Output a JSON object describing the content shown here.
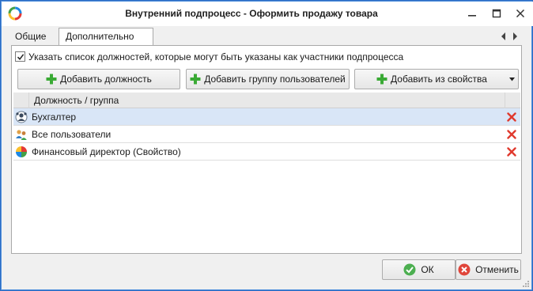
{
  "window": {
    "title": "Внутренний подпроцесс - Оформить продажу товара",
    "icons": {
      "logo": "app-logo-icon",
      "minimize": "minimize-icon",
      "maximize": "maximize-icon",
      "close": "close-icon"
    }
  },
  "tabs": [
    {
      "label": "Общие",
      "active": false
    },
    {
      "label": "Дополнительно",
      "active": true
    }
  ],
  "panel": {
    "checkbox": {
      "checked": true,
      "label": "Указать список должностей, которые могут быть указаны как участники подпроцесса"
    },
    "buttons": {
      "add_position": "Добавить должность",
      "add_group": "Добавить группу пользователей",
      "add_from_property": "Добавить из свойства"
    },
    "list": {
      "column_header": "Должность / группа",
      "rows": [
        {
          "label": "Бухгалтер",
          "icon": "position-icon",
          "selected": true
        },
        {
          "label": "Все пользователи",
          "icon": "users-group-icon",
          "selected": false
        },
        {
          "label": "Финансовый директор (Свойство)",
          "icon": "property-icon",
          "selected": false
        }
      ]
    }
  },
  "footer": {
    "ok_label": "ОК",
    "cancel_label": "Отменить"
  },
  "colors": {
    "window_border": "#2b6cc4",
    "selected_row": "#d9e6f7",
    "plus_green": "#3aaa35",
    "delete_red": "#e03a2e",
    "ok_green": "#4caf50",
    "cancel_red": "#e0453a"
  }
}
